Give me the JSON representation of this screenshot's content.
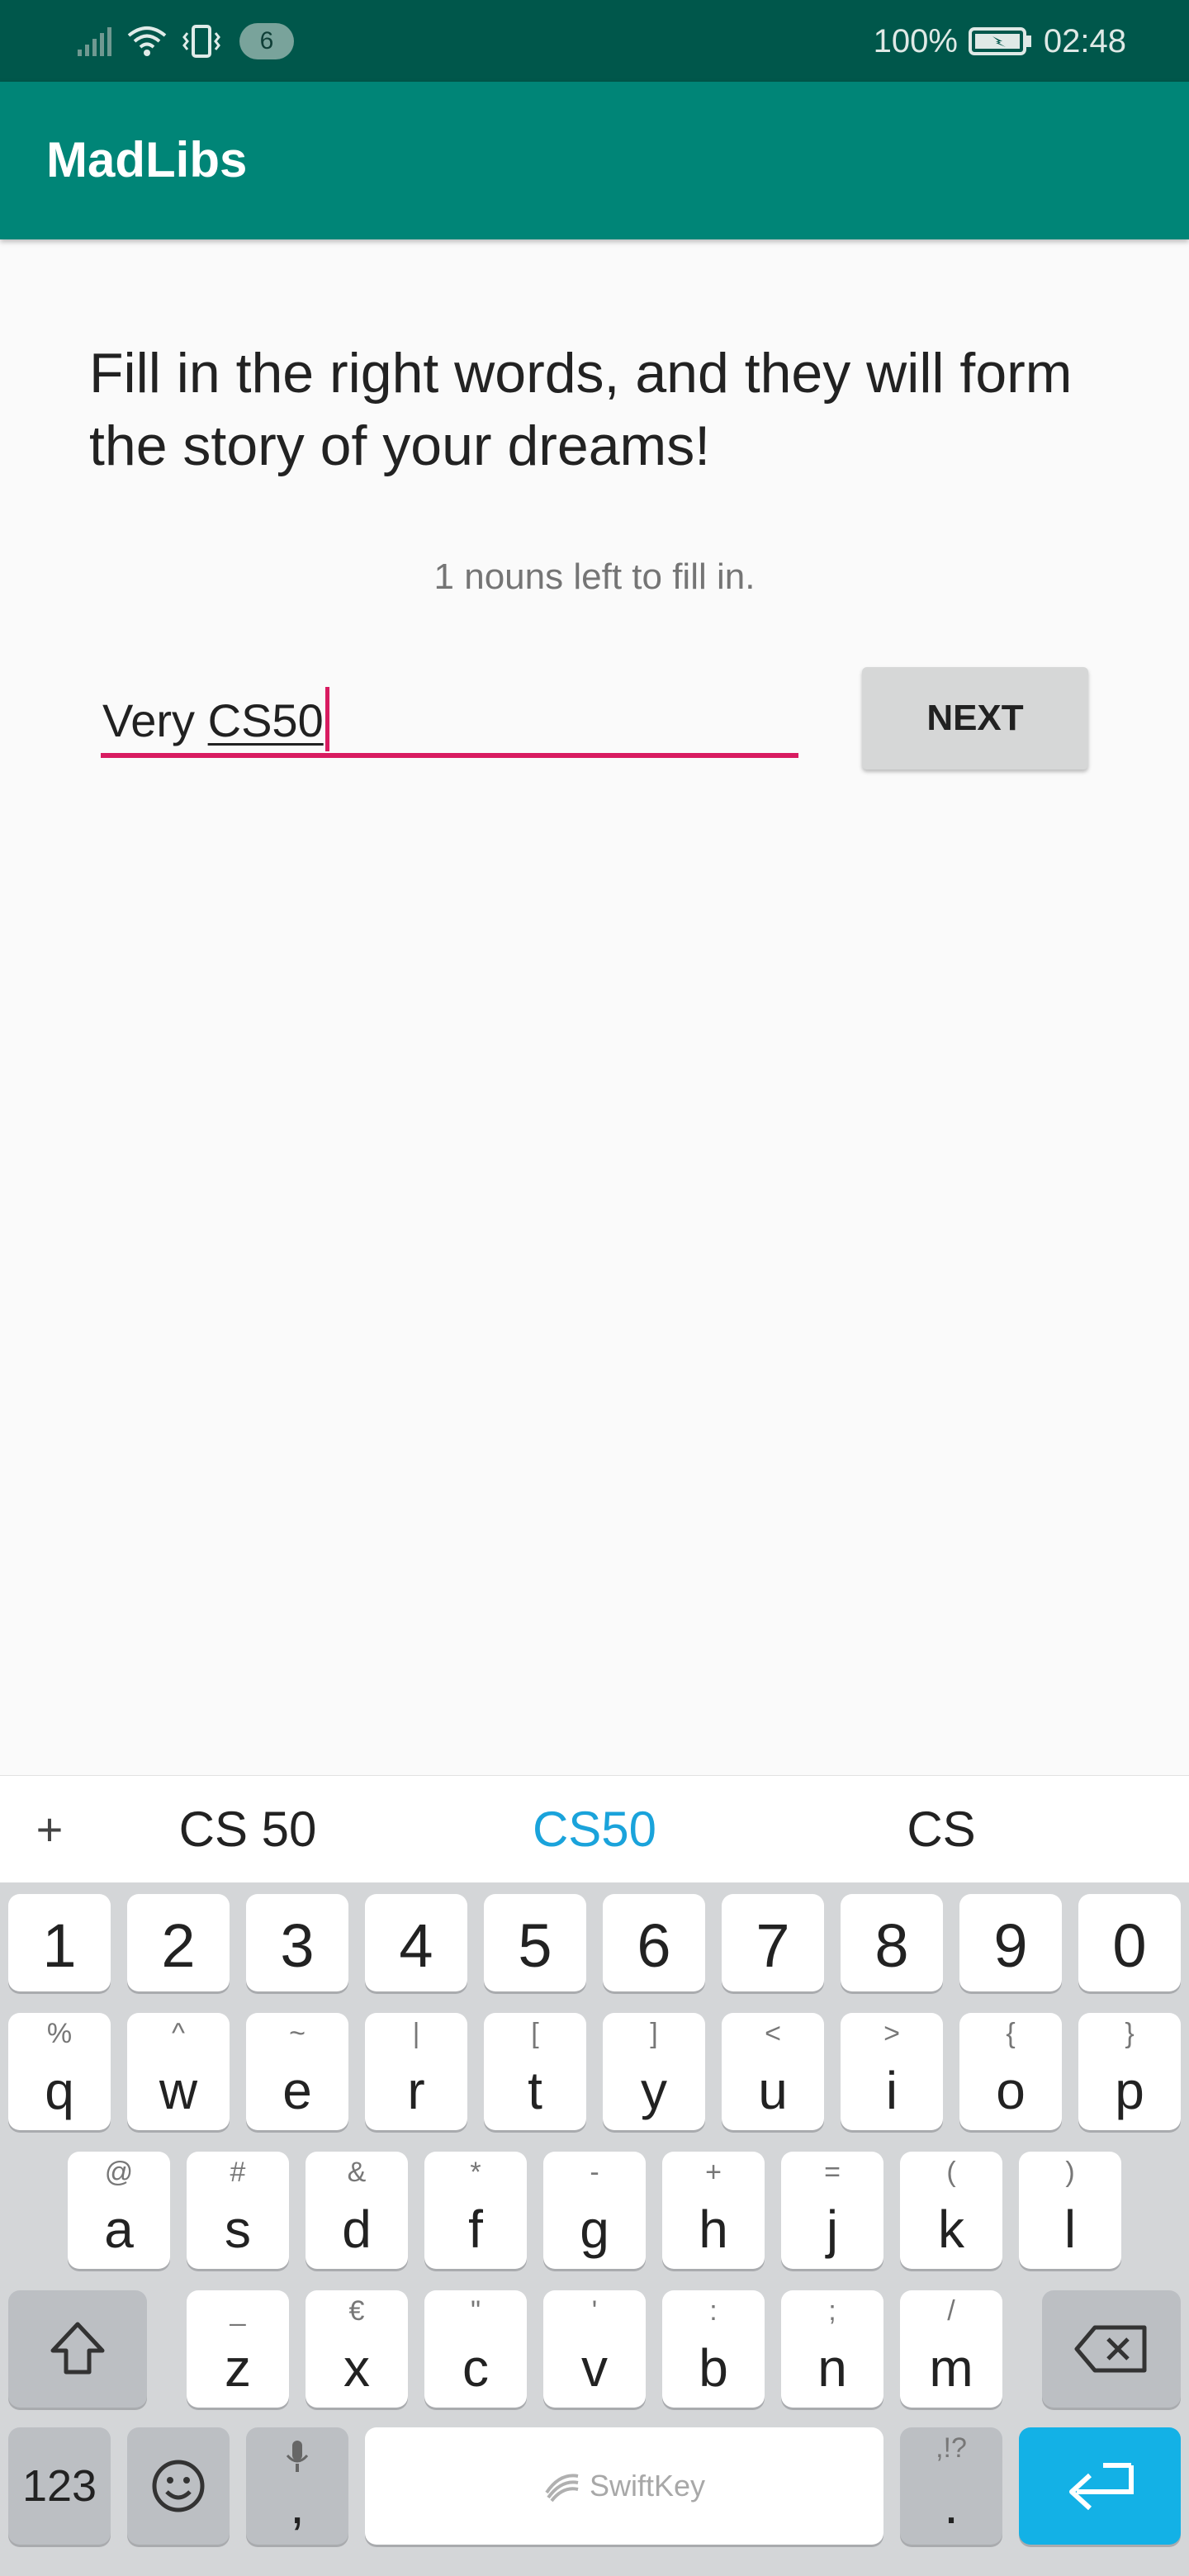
{
  "status_bar": {
    "notification_count": "6",
    "battery": "100%",
    "time": "02:48"
  },
  "app_bar": {
    "title": "MadLibs"
  },
  "main": {
    "instruction": "Fill in the right words, and they will form the story of your dreams!",
    "remaining": "1 nouns left to fill in.",
    "input": {
      "typed_prefix": "Very ",
      "composing": "CS50"
    },
    "next_label": "NEXT"
  },
  "suggestions": {
    "add": "+",
    "left": "CS 50",
    "center": "CS50",
    "right": "CS"
  },
  "keyboard": {
    "number_row": [
      "1",
      "2",
      "3",
      "4",
      "5",
      "6",
      "7",
      "8",
      "9",
      "0"
    ],
    "row1": {
      "keys": [
        "q",
        "w",
        "e",
        "r",
        "t",
        "y",
        "u",
        "i",
        "o",
        "p"
      ],
      "secondary": [
        "%",
        "^",
        "~",
        "|",
        "[",
        "]",
        "<",
        ">",
        "{",
        "}"
      ]
    },
    "row2": {
      "keys": [
        "a",
        "s",
        "d",
        "f",
        "g",
        "h",
        "j",
        "k",
        "l"
      ],
      "secondary": [
        "@",
        "#",
        "&",
        "*",
        "-",
        "+",
        "=",
        "(",
        ")"
      ]
    },
    "row3": {
      "keys": [
        "z",
        "x",
        "c",
        "v",
        "b",
        "n",
        "m"
      ],
      "secondary": [
        "_",
        "€",
        "\"",
        "'",
        ":",
        ";",
        "/"
      ]
    },
    "mode_key": "123",
    "comma_key": ",",
    "period_key": ".",
    "period_secondary": ",!?",
    "space_brand": "SwiftKey",
    "accent_color": "#13b1e6"
  }
}
